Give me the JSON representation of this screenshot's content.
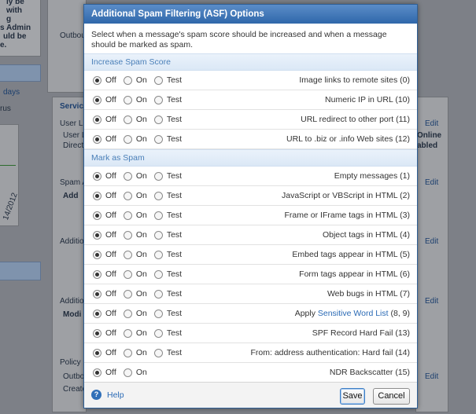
{
  "background": {
    "left_text_1": "ly be",
    "left_text_2": "with",
    "left_text_3": "g",
    "left_text_4": "s Admin",
    "left_text_5": "uld be",
    "left_text_6": "e.",
    "left_days": "days",
    "left_rus": "rus",
    "date": "14/2012",
    "outbound_label": "Outbou",
    "service_label": "Servic",
    "user_li_1": "User Li",
    "user_li_2": "User L",
    "direct": "Direct",
    "spam_a": "Spam A",
    "add": "Add",
    "additio_1": "Additio",
    "additio_2": "Additio",
    "modi": "Modi",
    "policy": "Policy F",
    "outbo": "Outbo",
    "create": "Create",
    "online": "Online",
    "abled": "abled",
    "edit": "Edit"
  },
  "dialog": {
    "title": "Additional Spam Filtering (ASF) Options",
    "intro": "Select when a message's spam score should be increased and when a message should be marked as spam.",
    "option_labels": {
      "off": "Off",
      "on": "On",
      "test": "Test"
    },
    "sections": [
      {
        "title": "Increase Spam Score",
        "rows": [
          {
            "label": "Image links to remote sites (0)"
          },
          {
            "label": "Numeric IP in URL (10)"
          },
          {
            "label": "URL redirect to other port (11)"
          },
          {
            "label": "URL to .biz or .info Web sites (12)"
          }
        ]
      },
      {
        "title": "Mark as Spam",
        "rows": [
          {
            "label": "Empty messages (1)"
          },
          {
            "label": "JavaScript or VBScript in HTML (2)"
          },
          {
            "label": "Frame or IFrame tags in HTML (3)"
          },
          {
            "label": "Object tags in HTML (4)"
          },
          {
            "label": "Embed tags appear in HTML (5)"
          },
          {
            "label": "Form tags appear in HTML (6)"
          },
          {
            "label": "Web bugs in HTML (7)"
          },
          {
            "label_prefix": "Apply ",
            "label_link": "Sensitive Word List",
            "label_suffix": " (8, 9)"
          },
          {
            "label": "SPF Record Hard Fail (13)"
          },
          {
            "label": "From: address authentication: Hard fail (14)"
          },
          {
            "label": "NDR Backscatter (15)"
          }
        ]
      }
    ],
    "help_label": "Help",
    "save_label": "Save",
    "cancel_label": "Cancel"
  }
}
